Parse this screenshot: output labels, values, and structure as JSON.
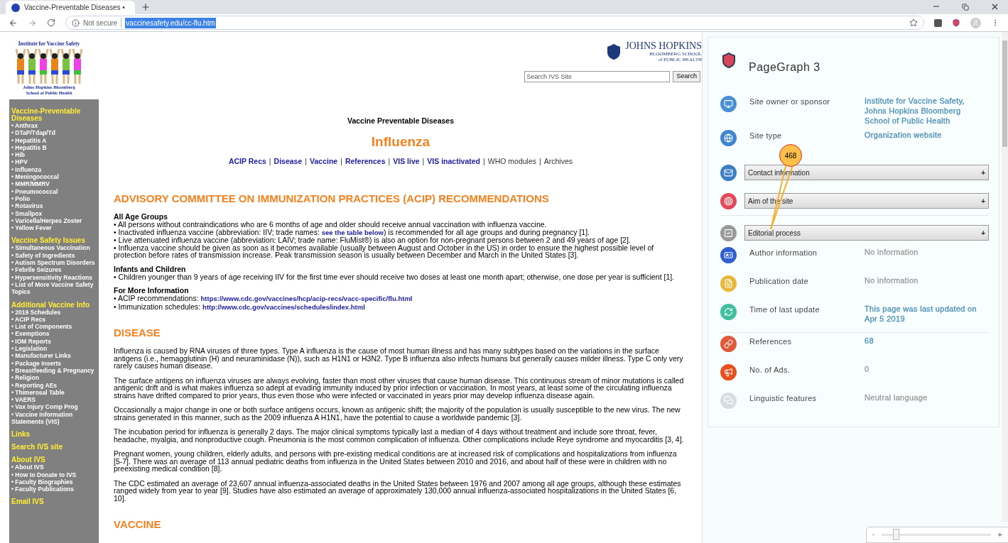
{
  "browser": {
    "tab_title": "Vaccine-Preventable Diseases •",
    "security": "Not secure",
    "url": "vaccinesafety.edu/cc-flu.htm"
  },
  "site": {
    "logo": {
      "top": "Institute for Vaccine Safety",
      "bottom": [
        "Johns Hopkins Bloomberg",
        "School of Public Health"
      ]
    },
    "sidebar": [
      {
        "title": "Vaccine-Preventable Diseases",
        "items": [
          "• Anthrax",
          "• DTaP/Tdap/Td",
          "• Hepatitis A",
          "• Hepatitis B",
          "• Hib",
          "• HPV",
          "• Influenza",
          "• Meningococcal",
          "• MMR/MMRV",
          "• Pneumococcal",
          "• Polio",
          "• Rotavirus",
          "• Smallpox",
          "• Varicella/Herpes Zoster",
          "• Yellow Fever"
        ]
      },
      {
        "title": "Vaccine Safety Issues",
        "items": [
          "• Simultaneous Vaccination",
          "• Safety of Ingredients",
          "• Autism Spectrum Disorders",
          "• Febrile Seizures",
          "• Hypersensitivity Reactions",
          "• List of More Vaccine Safety Topics"
        ]
      },
      {
        "title": "Additional Vaccine Info",
        "items": [
          "• 2019 Schedules",
          "• ACIP Recs",
          "• List of Components",
          "• Exemptions",
          "• IOM Reports",
          "• Legislation",
          "• Manufacturer Links",
          "• Package Inserts",
          "• Breastfeeding & Pregnancy",
          "• Religion",
          "• Reporting AEs",
          "• Thimerosal Table",
          "• VAERS",
          "• Vax Injury Comp Prog",
          "• Vaccine Information Statements (VIS)"
        ]
      },
      {
        "title": "Links"
      },
      {
        "title": "Search IVS site"
      },
      {
        "title": "About IVS",
        "items": [
          "• About IVS",
          "• How to Donate to IVS",
          "• Faculty Biographies",
          "• Faculty Publications"
        ]
      },
      {
        "title": "Email IVS"
      }
    ],
    "school_logo": [
      "JOHNS HOPKINS",
      "BLOOMBERG SCHOOL",
      "of PUBLIC HEALTH"
    ],
    "search": {
      "placeholder": "Search IVS Site",
      "button": "Search"
    },
    "kicker": "Vaccine Preventable Diseases",
    "title": "Influenza",
    "separator": "|",
    "nav": [
      {
        "text": "ACIP Recs",
        "link": true
      },
      {
        "text": "Disease",
        "link": true
      },
      {
        "text": "Vaccine",
        "link": true
      },
      {
        "text": "References",
        "link": true
      },
      {
        "text": "VIS live",
        "link": true
      },
      {
        "text": "VIS inactivated",
        "link": true
      },
      {
        "text": "WHO modules",
        "link": false
      },
      {
        "text": "Archives",
        "link": false
      }
    ],
    "sections": [
      {
        "heading": "ADVISORY COMMITTEE ON IMMUNIZATION PRACTICES (ACIP) RECOMMENDATIONS",
        "blocks": [
          {
            "title": "All Age Groups",
            "lines": [
              [
                {
                  "t": "• All persons without contraindications who are 6 months of age and older should receive annual vaccination with influenza vaccine."
                }
              ],
              [
                {
                  "t": "• Inactivated influenza vaccine (abbreviation: IIV; trade names: ",
                  "kind": "text"
                },
                {
                  "t": "see the table below",
                  "kind": "link"
                },
                {
                  "t": ") is recommended for all age groups and during pregnancy [1].",
                  "kind": "text"
                }
              ],
              [
                {
                  "t": "• Live attenuated influenza vaccine (abbreviation: LAIV; trade name: FluMist®) is also an option for non-pregnant persons between 2 and 49 years of age [2]."
                }
              ],
              [
                {
                  "t": "• Influenza vaccine should be given as soon as it becomes available (usually between August and October in the US) in order to ensure the highest possible level of protection before rates of transmission increase. Peak transmission season is usually between December and March in the United States [3]."
                }
              ]
            ]
          },
          {
            "title": "Infants and Children",
            "lines": [
              [
                {
                  "t": "• Children younger than 9 years of age receiving IIV for the first time ever should receive two doses at least one month apart; otherwise, one dose per year is sufficient [1]."
                }
              ]
            ]
          },
          {
            "title": "For More Information",
            "lines": [
              [
                {
                  "t": "• ACIP recommendations: ",
                  "kind": "text"
                },
                {
                  "t": "https://www.cdc.gov/vaccines/hcp/acip-recs/vacc-specific/flu.html",
                  "kind": "link"
                }
              ],
              [
                {
                  "t": "• Immunization schedules: ",
                  "kind": "text"
                },
                {
                  "t": "http://www.cdc.gov/vaccines/schedules/index.html",
                  "kind": "link"
                }
              ]
            ]
          }
        ]
      },
      {
        "heading": "DISEASE",
        "paragraphs": [
          "Influenza is caused by RNA viruses of three types. Type A influenza is the cause of most human illness and has many subtypes based on the variations in the surface antigens (i.e., hemagglutinin (H) and neuraminidase (N)), such as H1N1 or H3N2. Type B influenza also infects humans but generally causes milder illness. Type C only very rarely causes human disease.",
          "The surface antigens on influenza viruses are always evolving, faster than most other viruses that cause human disease. This continuous stream of minor mutations is called antigenic drift and is what makes influenza so adept at evading immunity induced by prior infection or vaccination. In most years, at least some of the circulating influenza strains have drifted compared to prior years, thus even those who were infected or vaccinated in years prior may develop influenza disease again.",
          "Occasionally a major change in one or both surface antigens occurs, known as antigenic shift; the majority of the population is usually susceptible to the new virus. The new strains generated in this manner, such as the 2009 influenza A H1N1, have the potential to cause a worldwide pandemic [3].",
          "The incubation period for influenza is generally 2 days. The major clinical symptoms typically last a median of 4 days without treatment and include sore throat, fever, headache, myalgia, and nonproductive cough. Pneumonia is the most common complication of influenza. Other complications include Reye syndrome and myocarditis [3, 4].",
          "Pregnant women, young children, elderly adults, and persons with pre-existing medical conditions are at increased risk of complications and hospitalizations from influenza [5-7]. There was an average of 113 annual pediatric deaths from influenza in the United States between 2010 and 2016, and about half of these were in children with no preexisting medical condition [8].",
          "The CDC estimated an average of 23,607 annual influenza-associated deaths in the United States between 1976 and 2007 among all age groups, although these estimates ranged widely from year to year [9]. Studies have also estimated an average of approximately 130,000 annual influenza-associated hospitalizations in the United States [6, 10]."
        ]
      },
      {
        "heading": "VACCINE"
      }
    ]
  },
  "panel": {
    "title": "PageGraph 3",
    "groups": [
      [
        {
          "kind": "info",
          "label": "Site owner or sponsor",
          "value": "Institute for Vaccine Safety, Johns Hopkins Bloomberg School of Public Health",
          "color": "#4a8fb8"
        },
        {
          "kind": "info",
          "label": "Site type",
          "value": "Organization website",
          "color": "#4a8fb8"
        },
        {
          "kind": "accordion",
          "label": "Contact information",
          "toggle": "+"
        },
        {
          "kind": "accordion",
          "label": "Aim of the site",
          "toggle": "+"
        }
      ],
      [
        {
          "kind": "accordion",
          "label": "Editorial process",
          "toggle": "+"
        },
        {
          "kind": "info",
          "label": "Author information",
          "value": "No information",
          "color": "#999999"
        },
        {
          "kind": "info",
          "label": "Publication date",
          "value": "No information",
          "color": "#999999"
        },
        {
          "kind": "info",
          "label": "Time of last update",
          "value": "This page was last updated on Apr 5 2019",
          "color": "#4a8fb8"
        }
      ],
      [
        {
          "kind": "info",
          "label": "References",
          "value": "68",
          "color": "#4a8fb8"
        },
        {
          "kind": "info",
          "label": "No. of Ads.",
          "value": "0",
          "color": "#999999"
        },
        {
          "kind": "info",
          "label": "Linguistic features",
          "value": "Neutral language",
          "color": "#999999"
        }
      ]
    ]
  },
  "marker": {
    "count": "468"
  },
  "zoom_control": {
    "minus": "-",
    "plus": "+",
    "level": 0.13
  }
}
